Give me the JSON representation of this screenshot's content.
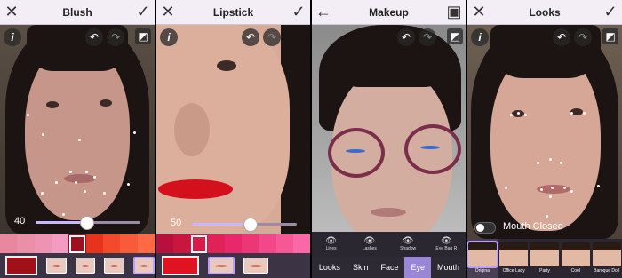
{
  "colors": {
    "accent": "#9a86d6",
    "topbar": "#f3eef6",
    "tray": "#3c3345"
  },
  "blush": {
    "title": "Blush",
    "close_icon": "✕",
    "confirm_icon": "✓",
    "info_icon": "i",
    "undo_icon": "↶",
    "redo_icon": "↷",
    "compare_icon": "◩",
    "slider_value": "40",
    "slider_level": 0.48,
    "swatch_colors": [
      "#e9879e",
      "#e98fa6",
      "#ee93b2",
      "#f29cc2",
      "#9e1020",
      "#e8331c",
      "#f34a2c",
      "#f85b3a",
      "#ff6a45"
    ],
    "selected_swatch": 4
  },
  "lipstick": {
    "title": "Lipstick",
    "close_icon": "✕",
    "confirm_icon": "✓",
    "info_icon": "i",
    "undo_icon": "↶",
    "redo_icon": "↷",
    "slider_value": "50",
    "slider_level": 0.55,
    "swatch_colors": [
      "#b7103c",
      "#c8163e",
      "#d81c4a",
      "#e02256",
      "#e8286a",
      "#ec3676",
      "#f2488a",
      "#f65896",
      "#fa68a8"
    ],
    "selected_swatch": 2
  },
  "makeup": {
    "title": "Makeup",
    "back_icon": "←",
    "save_icon": "▣",
    "undo_icon": "↶",
    "redo_icon": "↷",
    "compare_icon": "◩",
    "eye_categories": [
      "Lines",
      "Lashes",
      "Shadow",
      "Eye Bag R"
    ],
    "tabs": [
      "Looks",
      "Skin",
      "Face",
      "Eye",
      "Mouth"
    ],
    "active_tab": "Eye"
  },
  "looks": {
    "title": "Looks",
    "close_icon": "✕",
    "confirm_icon": "✓",
    "info_icon": "i",
    "undo_icon": "↶",
    "redo_icon": "↷",
    "compare_icon": "◩",
    "toggle_label": "Mouth Closed",
    "presets": [
      "Original",
      "Office Lady",
      "Party",
      "Cool",
      "Baroque Doll"
    ],
    "selected_preset": "Original"
  }
}
